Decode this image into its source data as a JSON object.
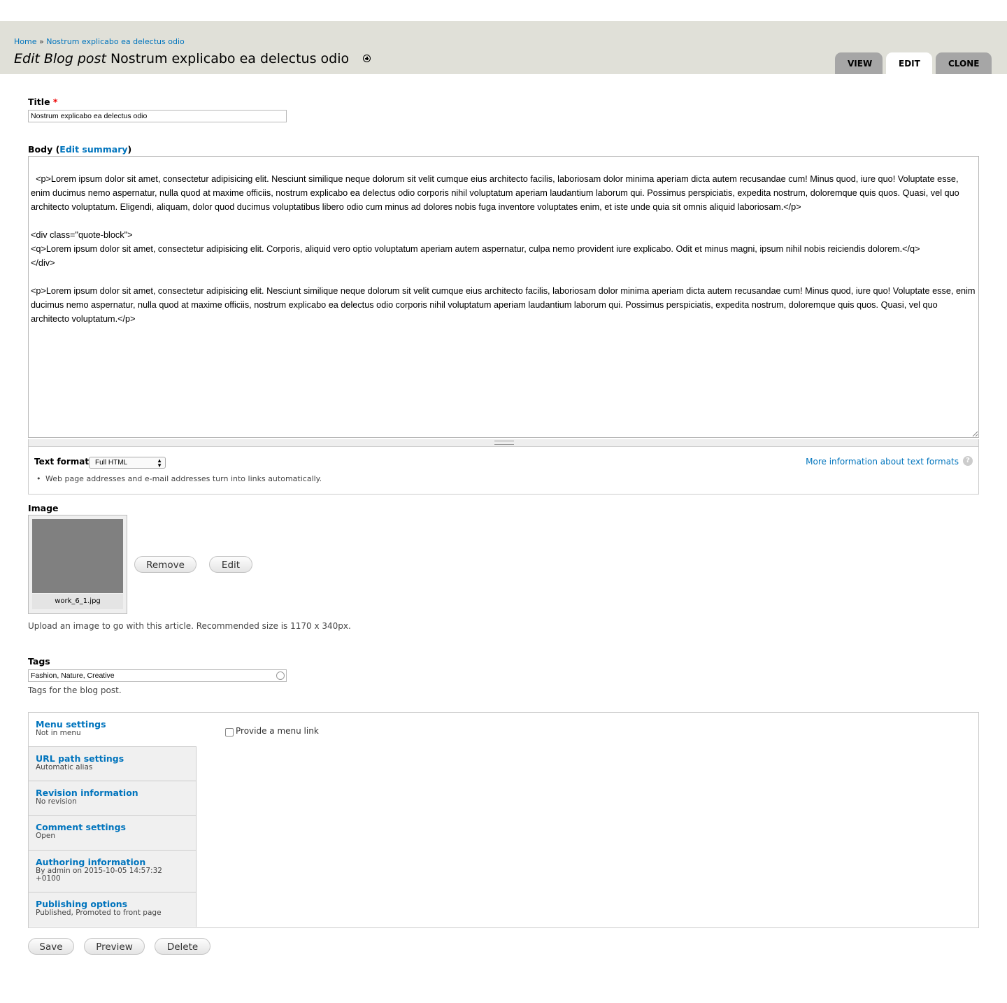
{
  "breadcrumb": {
    "home": "Home",
    "sep": "»",
    "current": "Nostrum explicabo ea delectus odio"
  },
  "page": {
    "title_prefix": "Edit Blog post",
    "title": "Nostrum explicabo ea delectus odio"
  },
  "tabs": [
    {
      "label": "VIEW"
    },
    {
      "label": "EDIT"
    },
    {
      "label": "CLONE"
    }
  ],
  "title_field": {
    "label": "Title",
    "required": "*",
    "value": "Nostrum explicabo ea delectus odio"
  },
  "body": {
    "label": "Body",
    "paren_open": "(",
    "edit_summary": "Edit summary",
    "paren_close": ")",
    "value": "<p>Lorem ipsum dolor sit amet, consectetur adipisicing elit. Nesciunt similique neque dolorum sit velit cumque eius architecto facilis, laboriosam dolor minima aperiam dicta autem recusandae cum! Minus quod, iure quo! Voluptate esse, enim ducimus nemo aspernatur, nulla quod at maxime officiis, nostrum explicabo ea delectus odio corporis nihil voluptatum aperiam laudantium laborum qui. Possimus perspiciatis, expedita nostrum, doloremque quis quos. Quasi, vel quo architecto voluptatum. Eligendi, aliquam, dolor quod ducimus voluptatibus libero odio cum minus ad dolores nobis fuga inventore voluptates enim, et iste unde quia sit omnis aliquid laboriosam.</p>\n\n<div class=\"quote-block\">\n<q>Lorem ipsum dolor sit amet, consectetur adipisicing elit. Corporis, aliquid vero optio voluptatum aperiam autem aspernatur, culpa nemo provident iure explicabo. Odit et minus magni, ipsum nihil nobis reiciendis dolorem.</q>\n</div>\n\n<p>Lorem ipsum dolor sit amet, consectetur adipisicing elit. Nesciunt similique neque dolorum sit velit cumque eius architecto facilis, laboriosam dolor minima aperiam dicta autem recusandae cum! Minus quod, iure quo! Voluptate esse, enim ducimus nemo aspernatur, nulla quod at maxime officiis, nostrum explicabo ea delectus odio corporis nihil voluptatum aperiam laudantium laborum qui. Possimus perspiciatis, expedita nostrum, doloremque quis quos. Quasi, vel quo architecto voluptatum.</p>"
  },
  "text_format": {
    "label": "Text format",
    "selected": "Full HTML",
    "help_link": "More information about text formats",
    "help_icon": "?",
    "tip": "Web page addresses and e-mail addresses turn into links automatically."
  },
  "image": {
    "label": "Image",
    "filename": "work_6_1.jpg",
    "remove_label": "Remove",
    "edit_label": "Edit",
    "description": "Upload an image to go with this article. Recommended size is 1170 x 340px."
  },
  "tags": {
    "label": "Tags",
    "value": "Fashion, Nature, Creative",
    "description": "Tags for the blog post."
  },
  "vertical_tabs": [
    {
      "title": "Menu settings",
      "summary": "Not in menu"
    },
    {
      "title": "URL path settings",
      "summary": "Automatic alias"
    },
    {
      "title": "Revision information",
      "summary": "No revision"
    },
    {
      "title": "Comment settings",
      "summary": "Open"
    },
    {
      "title": "Authoring information",
      "summary": "By admin on 2015-10-05 14:57:32 +0100"
    },
    {
      "title": "Publishing options",
      "summary": "Published, Promoted to front page"
    }
  ],
  "menu_pane": {
    "checkbox_label": "Provide a menu link"
  },
  "actions": {
    "save": "Save",
    "preview": "Preview",
    "delete": "Delete"
  },
  "colors": {
    "link": "#0074bd",
    "header_bg": "#e0e0d8",
    "tab_inactive": "#a6a6a6",
    "required": "#ee0000"
  }
}
